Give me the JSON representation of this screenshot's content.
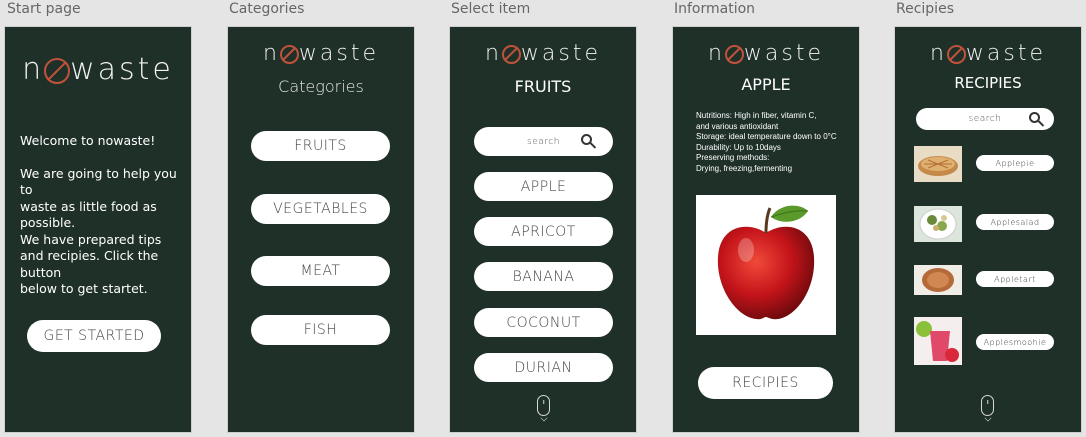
{
  "frames": {
    "start": "Start page",
    "categories": "Categories",
    "select": "Select item",
    "info": "Information",
    "recipes": "Recipies"
  },
  "logo": {
    "prefix": "n",
    "suffix": "waste"
  },
  "start": {
    "welcome": "Welcome to nowaste!",
    "line1": "We are going to help you to",
    "line2": "waste as little food as",
    "line3": "possible.",
    "line4": "We have prepared tips",
    "line5": "and recipies. Click the button",
    "line6": "below to get startet.",
    "button": "GET STARTED"
  },
  "categories": {
    "heading": "Categories",
    "items": [
      "FRUITS",
      "VEGETABLES",
      "MEAT",
      "FISH"
    ]
  },
  "select": {
    "heading": "FRUITS",
    "search_placeholder": "search",
    "items": [
      "APPLE",
      "APRICOT",
      "BANANA",
      "COCONUT",
      "DURIAN"
    ]
  },
  "info": {
    "heading": "APPLE",
    "line1": "Nutritions:  High in fiber, vitamin C,",
    "line2": "and various antioxidant",
    "line3": "Storage: ideal temperature down to 0°C",
    "line4": "Durability: Up to 10days",
    "line5": "Preserving methods:",
    "line6": "Drying, freezing,fermenting",
    "button": "RECIPIES"
  },
  "recipes": {
    "heading": "RECIPIES",
    "search_placeholder": "search",
    "items": [
      "Applepie",
      "Applesalad",
      "Appletart",
      "Applesmoohie"
    ]
  },
  "colors": {
    "screen_bg": "#1f3029",
    "accent": "#c0523a",
    "page_bg": "#e5e5e5"
  },
  "icons": [
    "search-icon",
    "scroll-mouse-icon",
    "logo-slash-o-icon"
  ]
}
